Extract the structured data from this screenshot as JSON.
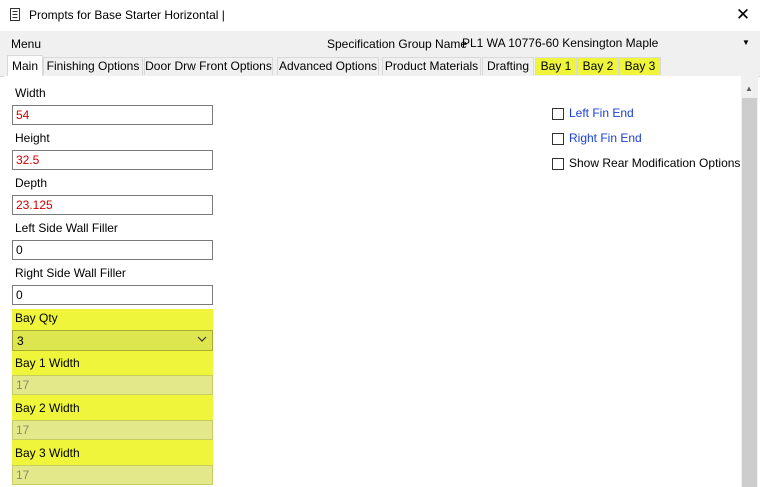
{
  "window": {
    "title": "Prompts for Base Starter Horizontal |",
    "close_glyph": "✕"
  },
  "menubar": {
    "menu_label": "Menu",
    "spec_group_label": "Specification Group Name",
    "spec_group_value": "PL1 WA 10776-60 Kensington Maple"
  },
  "tabs": [
    {
      "label": "Main"
    },
    {
      "label": "Finishing Options"
    },
    {
      "label": "Door Drw Front Options"
    },
    {
      "label": "Advanced Options"
    },
    {
      "label": "Product Materials"
    },
    {
      "label": "Drafting"
    },
    {
      "label": "Bay 1"
    },
    {
      "label": "Bay 2"
    },
    {
      "label": "Bay 3"
    }
  ],
  "fields": {
    "width": {
      "label": "Width",
      "value": "54"
    },
    "height": {
      "label": "Height",
      "value": "32.5"
    },
    "depth": {
      "label": "Depth",
      "value": "23.125"
    },
    "left_filler": {
      "label": "Left Side Wall Filler",
      "value": "0"
    },
    "right_filler": {
      "label": "Right Side Wall Filler",
      "value": "0"
    },
    "bay_qty": {
      "label": "Bay Qty",
      "value": "3"
    },
    "bay1_width": {
      "label": "Bay 1 Width",
      "value": "17"
    },
    "bay2_width": {
      "label": "Bay 2 Width",
      "value": "17"
    },
    "bay3_width": {
      "label": "Bay 3 Width",
      "value": "17"
    }
  },
  "options": {
    "left_fin_end": {
      "label": "Left Fin End",
      "checked": false
    },
    "right_fin_end": {
      "label": "Right Fin End",
      "checked": false
    },
    "rear_mod": {
      "label": "Show Rear Modification Options",
      "checked": false
    }
  },
  "colors": {
    "highlight": "#eef53a",
    "required_value": "#d10000",
    "link_label": "#1a3fd6"
  }
}
